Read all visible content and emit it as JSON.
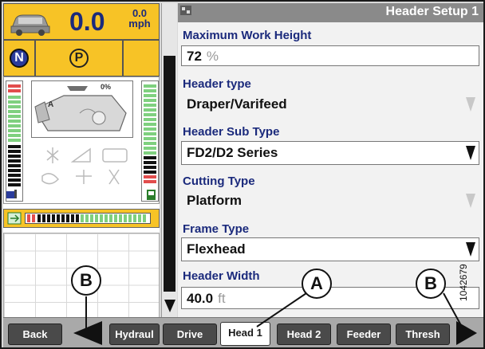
{
  "left_panel": {
    "speed_value": "0.0",
    "speed_small_value": "0.0",
    "speed_unit": "mph",
    "gear_n": "N",
    "gear_p": "P",
    "machine_percent": "0%",
    "icons": [
      "car-icon",
      "combine-icon",
      "fuel-level-icon",
      "engine-temp-icon",
      "fan-icon"
    ]
  },
  "setup": {
    "title": "Header Setup 1",
    "fields": [
      {
        "label": "Maximum Work Height",
        "value": "72",
        "unit": "%",
        "editable": true
      },
      {
        "label": "Header type",
        "value": "Draper/Varifeed",
        "unit": "",
        "dropdown_enabled": false
      },
      {
        "label": "Header Sub Type",
        "value": "FD2/D2 Series",
        "unit": "",
        "dropdown_enabled": true
      },
      {
        "label": "Cutting Type",
        "value": "Platform",
        "unit": "",
        "dropdown_enabled": false
      },
      {
        "label": "Frame Type",
        "value": "Flexhead",
        "unit": "",
        "dropdown_enabled": true
      },
      {
        "label": "Header Width",
        "value": "40.0",
        "unit": "ft",
        "editable": true
      }
    ]
  },
  "tabs": [
    {
      "label": "Back"
    },
    {
      "label": "Hydraul"
    },
    {
      "label": "Drive"
    },
    {
      "label": "Head 1",
      "active": true
    },
    {
      "label": "Head 2"
    },
    {
      "label": "Feeder"
    },
    {
      "label": "Thresh"
    }
  ],
  "callouts": {
    "left": "B",
    "middle": "A",
    "right": "B"
  },
  "figure_id": "1042679",
  "colors": {
    "accent_yellow": "#f7c326",
    "label_blue": "#1b2a7c",
    "title_bar": "#8a8a8a",
    "tab_dark": "#4a4a4a"
  }
}
